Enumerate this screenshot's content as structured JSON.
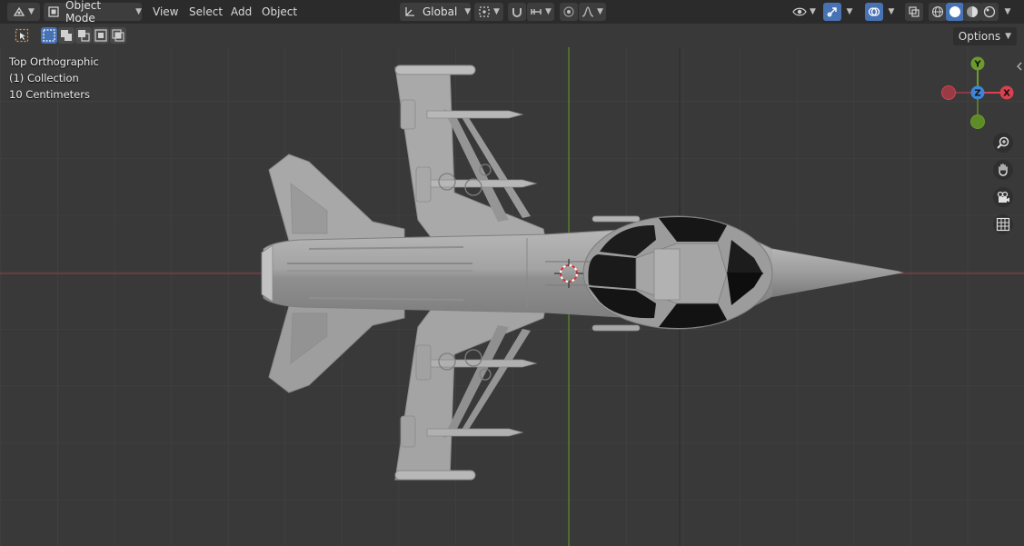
{
  "header": {
    "mode_label": "Object Mode",
    "menus": [
      "View",
      "Select",
      "Add",
      "Object"
    ],
    "transform_orientation": "Global"
  },
  "toolbar": {
    "options_label": "Options"
  },
  "viewport": {
    "view_name": "Top Orthographic",
    "collection": "(1) Collection",
    "grid_scale": "10 Centimeters"
  },
  "gizmo": {
    "x_label": "X",
    "y_label": "Y",
    "z_label": "Z"
  },
  "colors": {
    "x_axis": "#d9414f",
    "y_axis": "#6b9a2d",
    "z_axis": "#3f86d6",
    "accent": "#4772b3",
    "grid": "#434343",
    "background": "#393939"
  }
}
